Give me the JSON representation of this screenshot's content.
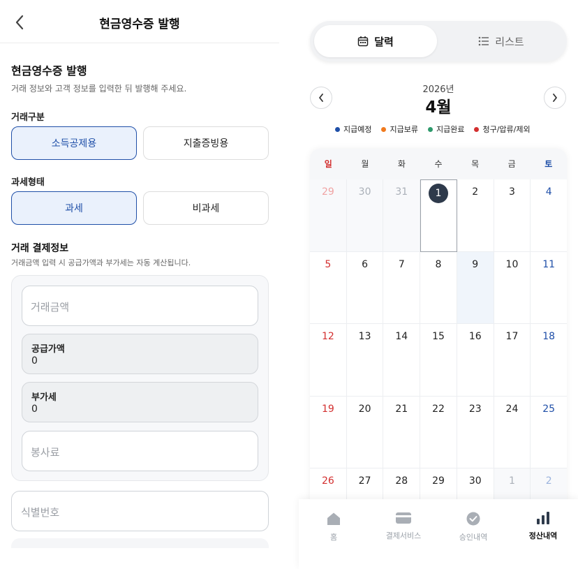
{
  "left": {
    "header": {
      "title": "현금영수증 발행"
    },
    "section": {
      "title": "현금영수증 발행",
      "description": "거래 정보와 고객 정보를 입력한 뒤 발행해 주세요."
    },
    "transaction_type": {
      "label": "거래구분",
      "options": [
        "소득공제용",
        "지출증빙용"
      ],
      "selected": "소득공제용"
    },
    "tax_type": {
      "label": "과세형태",
      "options": [
        "과세",
        "비과세"
      ],
      "selected": "과세"
    },
    "payment": {
      "title": "거래 결제정보",
      "description": "거래금액 입력 시 공급가액과 부가세는 자동 계산됩니다.",
      "amount_placeholder": "거래금액",
      "supply_label": "공급가액",
      "supply_value": "0",
      "vat_label": "부가세",
      "vat_value": "0",
      "service_fee_placeholder": "봉사료"
    },
    "identifier_placeholder": "식별번호"
  },
  "right": {
    "view_toggle": {
      "calendar": "달력",
      "list": "리스트",
      "selected": "달력"
    },
    "calendar": {
      "year": "2026년",
      "month": "4월",
      "weekdays": [
        "일",
        "월",
        "화",
        "수",
        "목",
        "금",
        "토"
      ],
      "weeks": [
        [
          "29",
          "30",
          "31",
          "1",
          "2",
          "3",
          "4"
        ],
        [
          "5",
          "6",
          "7",
          "8",
          "9",
          "10",
          "11"
        ],
        [
          "12",
          "13",
          "14",
          "15",
          "16",
          "17",
          "18"
        ],
        [
          "19",
          "20",
          "21",
          "22",
          "23",
          "24",
          "25"
        ],
        [
          "26",
          "27",
          "28",
          "29",
          "30",
          "1",
          "2"
        ]
      ],
      "selected_day": "1",
      "today_day": "9"
    },
    "legend": [
      {
        "label": "지급예정",
        "color": "#1f4fa8"
      },
      {
        "label": "지급보류",
        "color": "#f07a1e"
      },
      {
        "label": "지급완료",
        "color": "#2e9a6c"
      },
      {
        "label": "청구/압류/제외",
        "color": "#d32f2f"
      }
    ],
    "tabbar": [
      {
        "label": "홈",
        "icon": "home-icon"
      },
      {
        "label": "결제서비스",
        "icon": "credit-card-icon"
      },
      {
        "label": "승인내역",
        "icon": "check-circle-icon"
      },
      {
        "label": "정산내역",
        "icon": "bar-chart-icon"
      }
    ],
    "active_tab": "정산내역"
  },
  "colors": {
    "accent": "#1f4fa8",
    "selected_bg": "#eaf1fc",
    "sunday": "#d32f2f",
    "saturday": "#1f4fa8"
  }
}
